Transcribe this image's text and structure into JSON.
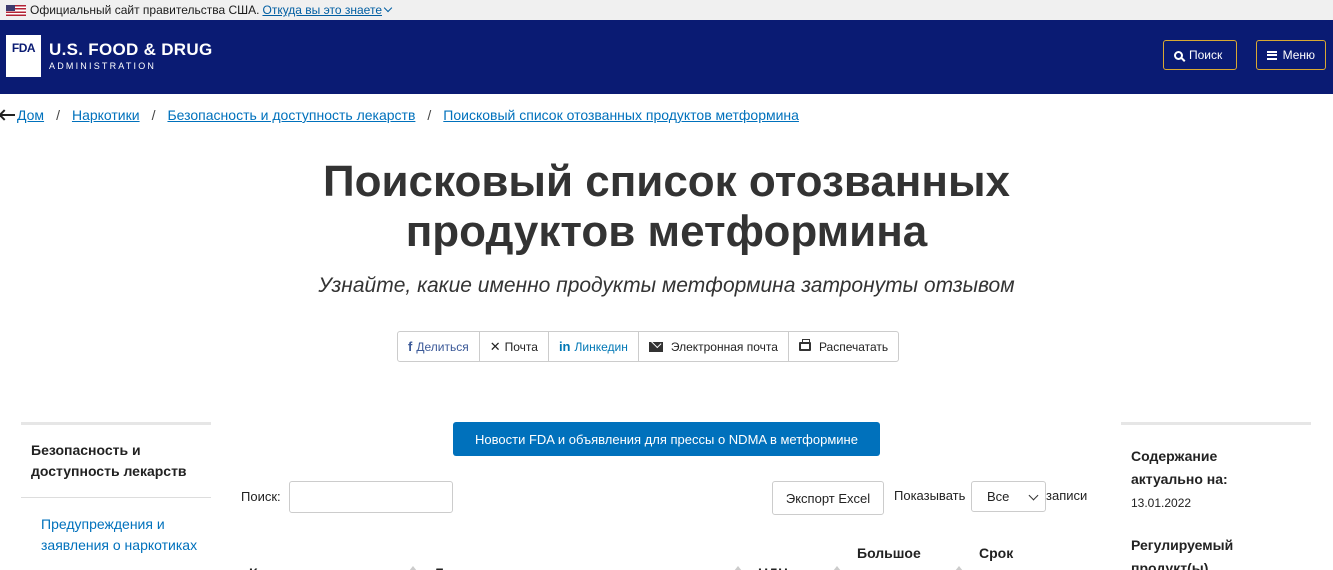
{
  "gov_banner": {
    "text": "Официальный сайт правительства США.",
    "link": "Откуда вы это знаете"
  },
  "header": {
    "logo_text": "FDA",
    "brand_line1": "U.S. FOOD & DRUG",
    "brand_line2": "ADMINISTRATION",
    "search_label": "Поиск",
    "menu_label": "Меню",
    "bg_color": "#0a1b73",
    "accent_color": "#d9a933"
  },
  "breadcrumb": [
    "Дом",
    "Наркотики",
    "Безопасность и доступность лекарств",
    "Поисковый список отозванных продуктов метформина"
  ],
  "page": {
    "title_line1": "Поисковый список отозванных",
    "title_line2": "продуктов метформина",
    "subtitle": "Узнайте, какие именно продукты метформина затронуты отзывом"
  },
  "share": {
    "facebook": "Делиться",
    "x": "Почта",
    "linkedin": "Линкедин",
    "email": "Электронная почта",
    "print": "Распечатать"
  },
  "sidebar_left": {
    "heading": "Безопасность и доступность лекарств",
    "link": "Предупреждения и заявления о наркотиках"
  },
  "sidebar_right": {
    "content_label": "Содержание актуально на:",
    "date": "13.01.2022",
    "regulated_label": "Регулируемый продукт(ы)"
  },
  "main": {
    "news_button": "Новости FDA и объявления для прессы о NDMA в метформине",
    "search_label": "Поиск:",
    "export_button": "Экспорт Excel",
    "show_label": "Показывать",
    "show_value": "Все",
    "records_label": "записи",
    "columns": [
      "Компания",
      "Лекарство",
      "НДЦ",
      "Большое число",
      "Срок действия"
    ]
  }
}
